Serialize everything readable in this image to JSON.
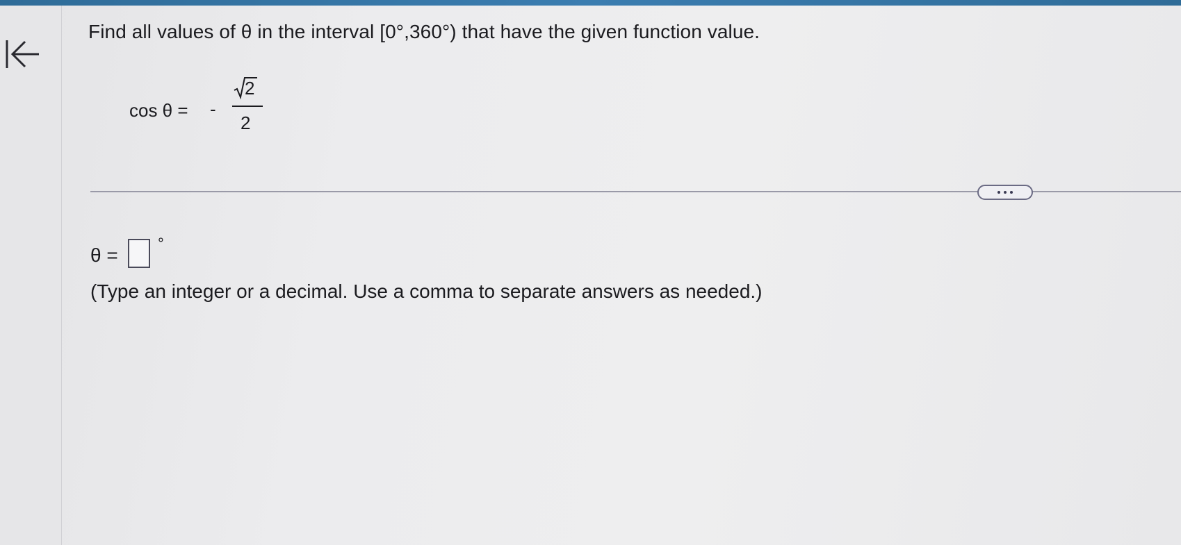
{
  "question": {
    "prompt": "Find all values of θ in the interval [0°,360°) that have the given function value."
  },
  "equation": {
    "lhs": "cos θ =",
    "minus": "-",
    "numerator_radicand": "2",
    "denominator": "2"
  },
  "toolbar": {
    "more_button_icon": "ellipsis-icon"
  },
  "answer": {
    "label": "θ =",
    "value": "",
    "unit": "°",
    "hint": "(Type an integer or a decimal. Use a comma to separate answers as needed.)"
  },
  "nav": {
    "collapse_icon": "collapse-left-icon"
  },
  "colors": {
    "top_bar": "#3b7db0",
    "text": "#1b1b1f",
    "background": "#ececee"
  }
}
